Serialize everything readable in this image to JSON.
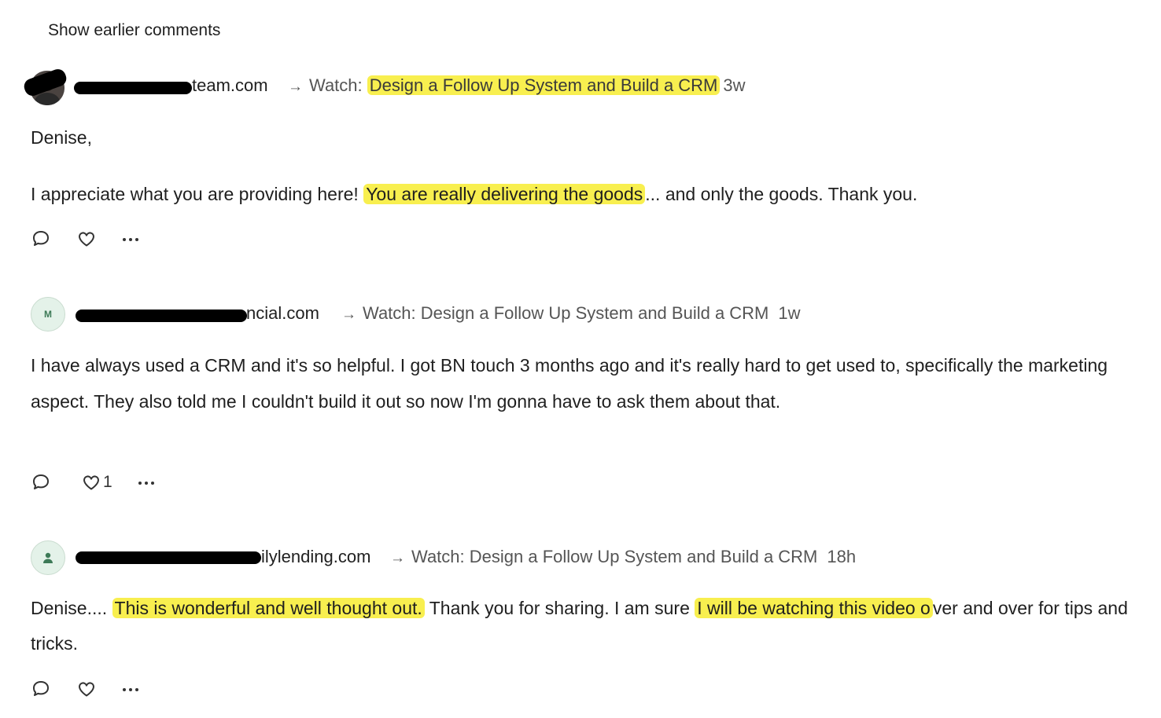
{
  "show_earlier": "Show earlier comments",
  "comments": [
    {
      "author_visible": "team.com",
      "watch_prefix": "Watch: ",
      "watch_title": "Design a Follow Up System and Build a CRM",
      "time": "3w",
      "greeting": "Denise,",
      "text_before": "I appreciate what you are providing here! ",
      "text_highlight": "You are really delivering the goods",
      "text_after": "... and only the goods. Thank you.",
      "likes": ""
    },
    {
      "avatar_letter": "M",
      "author_visible": "ncial.com",
      "watch_prefix": "Watch: ",
      "watch_title": "Design a Follow Up System and Build a CRM",
      "time": "1w",
      "text": "I have always used a CRM and it's so helpful. I got BN touch 3 months ago and it's really hard to get used to, specifically the marketing aspect. They also told me I couldn't build it out so now I'm gonna have to ask them about that.",
      "likes": "1"
    },
    {
      "author_visible": "ilylending.com",
      "watch_prefix": "Watch: ",
      "watch_title": "Design a Follow Up System and Build a CRM",
      "time": "18h",
      "text_start": "Denise.... ",
      "text_hl1": "This is wonderful and well thought out.",
      "text_mid": " Thank you for sharing. I am su",
      "text_mid2": "re ",
      "text_hl2": "I will be watching this video o",
      "text_end": "ver and over for tips and tricks.",
      "likes": ""
    }
  ],
  "colors": {
    "highlight": "#f8ef4f",
    "avatar_bg": "#e4f2e9",
    "avatar_fg": "#3d7a57"
  }
}
